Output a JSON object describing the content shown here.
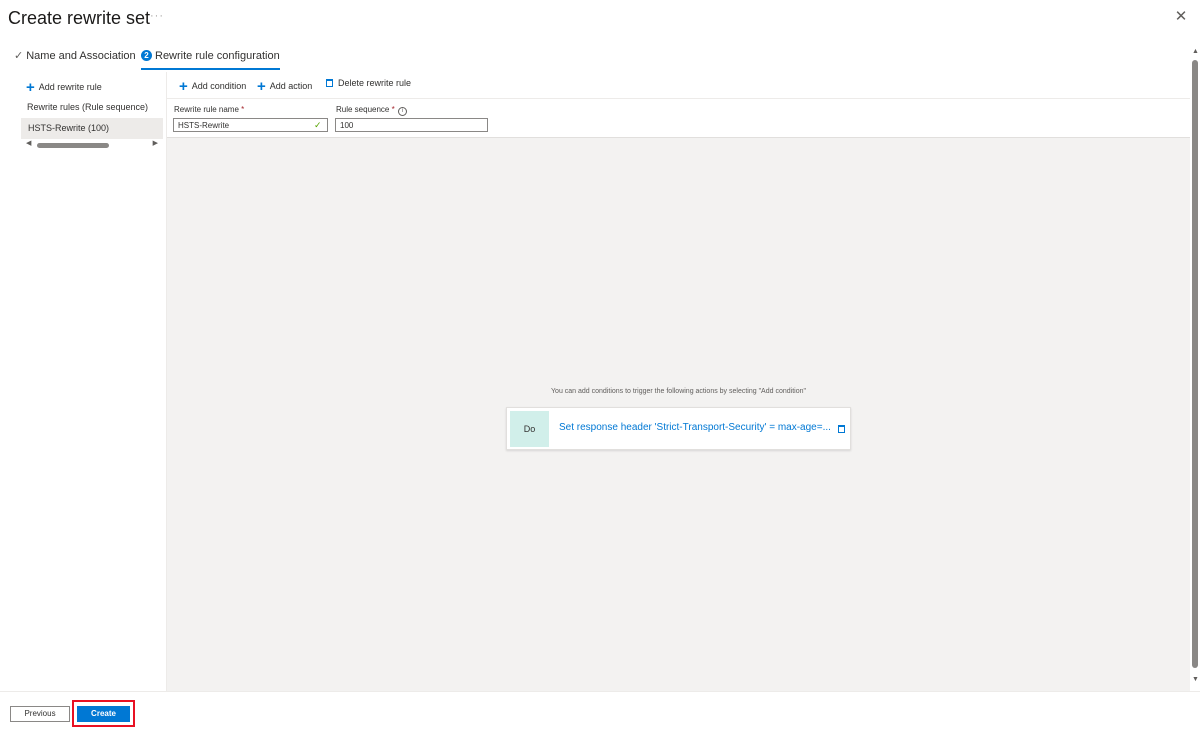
{
  "header": {
    "title": "Create rewrite set",
    "more": "···",
    "close": "✕"
  },
  "wizard": {
    "steps": [
      {
        "label": "Name and Association",
        "status": "completed"
      },
      {
        "number": "2",
        "label": "Rewrite rule configuration",
        "status": "active"
      }
    ]
  },
  "left_panel": {
    "add_rule_label": "Add rewrite rule",
    "rules_header": "Rewrite rules (Rule sequence)",
    "rules": [
      {
        "label": "HSTS-Rewrite (100)",
        "selected": true
      }
    ]
  },
  "toolbar": {
    "add_condition": "Add condition",
    "add_action": "Add action",
    "delete_rule": "Delete rewrite rule"
  },
  "form": {
    "rule_name_label": "Rewrite rule name",
    "rule_name_value": "HSTS-Rewrite",
    "rule_seq_label": "Rule sequence",
    "rule_seq_value": "100",
    "required_marker": "*",
    "info_symbol": "i"
  },
  "canvas": {
    "hint": "You can add conditions to trigger the following actions by selecting \"Add condition\"",
    "action": {
      "do_label": "Do",
      "text": "Set response header 'Strict-Transport-Security' = max-age=..."
    }
  },
  "footer": {
    "previous": "Previous",
    "create": "Create",
    "create_highlighted": true
  },
  "colors": {
    "accent": "#0078d4",
    "highlight": "#e81123",
    "do_box": "#d1efea",
    "canvas": "#f3f2f1",
    "valid": "#57a300",
    "required": "#a4262c"
  },
  "icons": {
    "check": "✓",
    "plus": "+",
    "arrow_left": "◀",
    "arrow_right": "▶",
    "arrow_up": "▲",
    "arrow_down": "▼"
  }
}
